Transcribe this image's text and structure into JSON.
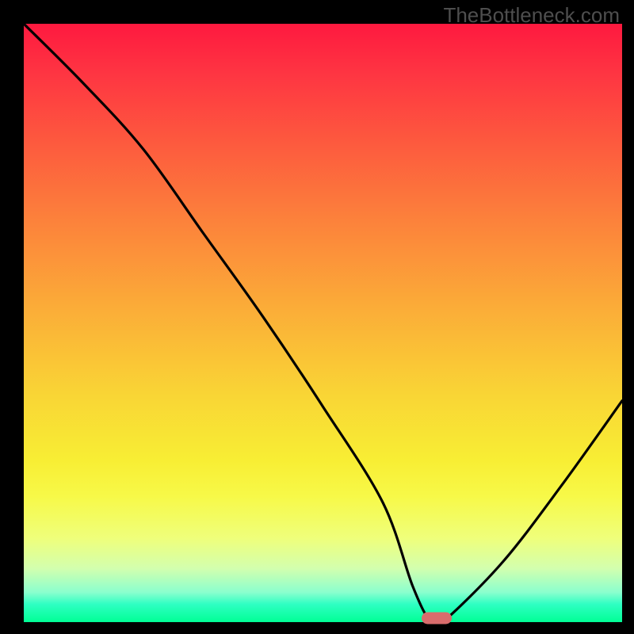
{
  "watermark": "TheBottleneck.com",
  "chart_data": {
    "type": "line",
    "title": "",
    "xlabel": "",
    "ylabel": "",
    "xlim": [
      0,
      100
    ],
    "ylim": [
      0,
      100
    ],
    "x": [
      0,
      10,
      20,
      30,
      40,
      50,
      60,
      65,
      68,
      70,
      80,
      90,
      100
    ],
    "y": [
      100,
      90,
      79,
      65,
      51,
      36,
      20,
      6,
      0,
      0,
      10,
      23,
      37
    ],
    "marker": {
      "x": 69,
      "y": 0
    },
    "gradient_colors_top_to_bottom": [
      "#fe193f",
      "#fe3442",
      "#fd5a3e",
      "#fc823b",
      "#fbab38",
      "#f9d535",
      "#f8ee34",
      "#f7f948",
      "#efff7b",
      "#d3ffae",
      "#8bffce",
      "#2fffc3",
      "#00ff95"
    ]
  },
  "plot_geometry": {
    "inner_left": 30,
    "inner_top": 30,
    "inner_width": 755,
    "inner_height": 755
  }
}
